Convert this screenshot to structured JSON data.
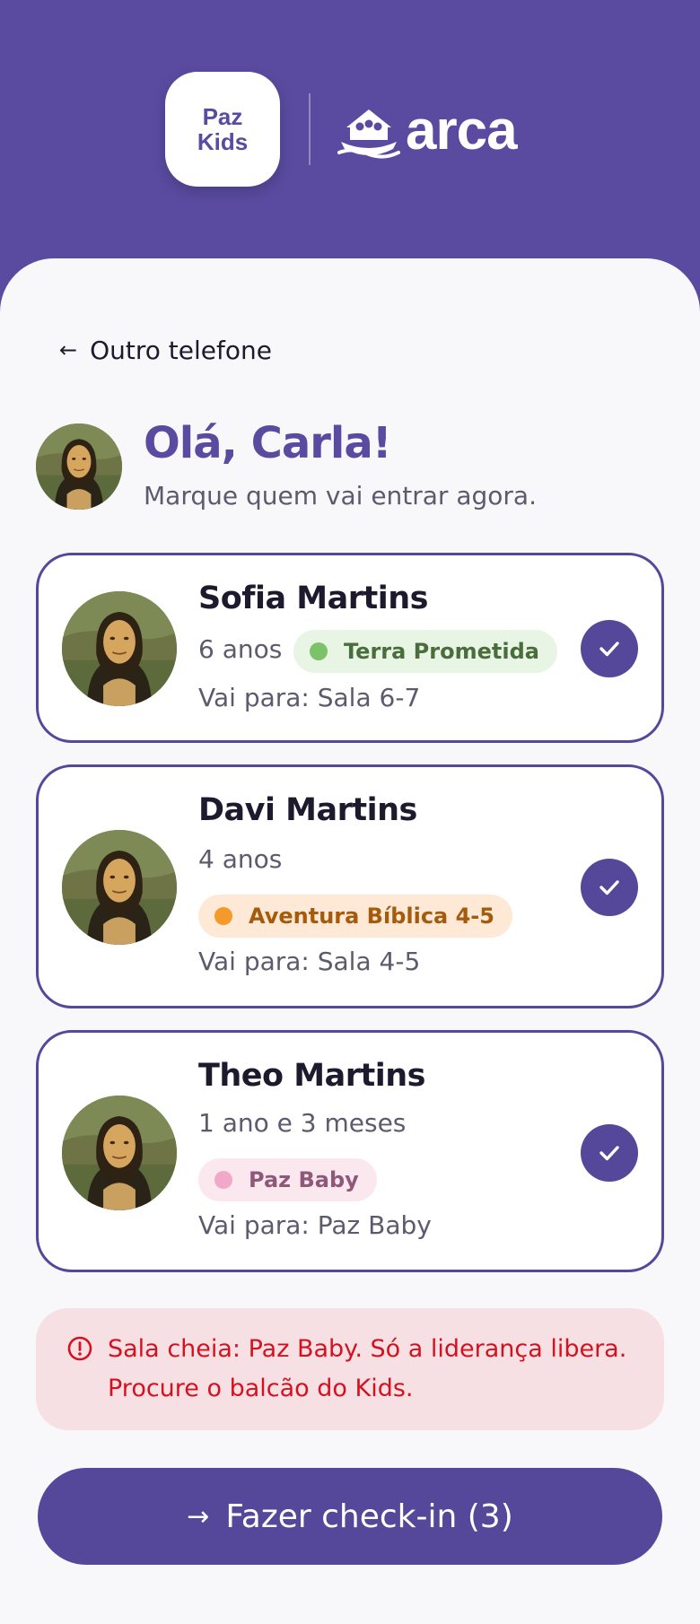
{
  "header": {
    "brand_left_line1": "Paz",
    "brand_left_line2": "Kids",
    "brand_right": "arca",
    "brand_right_icon": "ark-icon"
  },
  "nav": {
    "back_label": "Outro telefone",
    "back_icon": "arrow-left-icon"
  },
  "greeting": {
    "title": "Olá, Carla!",
    "subtitle": "Marque quem vai entrar agora."
  },
  "children": [
    {
      "name": "Sofia Martins",
      "age": "6 anos",
      "group": "Terra Prometida",
      "group_color": "#7cc26a",
      "destination": "Vai para: Sala 6-7",
      "selected": true
    },
    {
      "name": "Davi Martins",
      "age": "4 anos",
      "group": "Aventura Bíblica 4-5",
      "group_color": "#f39a2b",
      "destination": "Vai para: Sala 4-5",
      "selected": true
    },
    {
      "name": "Theo Martins",
      "age": "1 ano e 3 meses",
      "group": "Paz Baby",
      "group_color": "#f2a8c8",
      "destination": "Vai para: Paz Baby",
      "selected": true
    }
  ],
  "alert": {
    "icon": "alert-circle-icon",
    "text": "Sala cheia: Paz Baby. Só a liderança libera. Procure o balcão do Kids."
  },
  "cta": {
    "label": "Fazer check-in (3)",
    "icon": "arrow-right-icon"
  },
  "colors": {
    "brand": "#5a4ba0",
    "alert_text": "#d4121f",
    "alert_bg": "#f7e0e4"
  }
}
